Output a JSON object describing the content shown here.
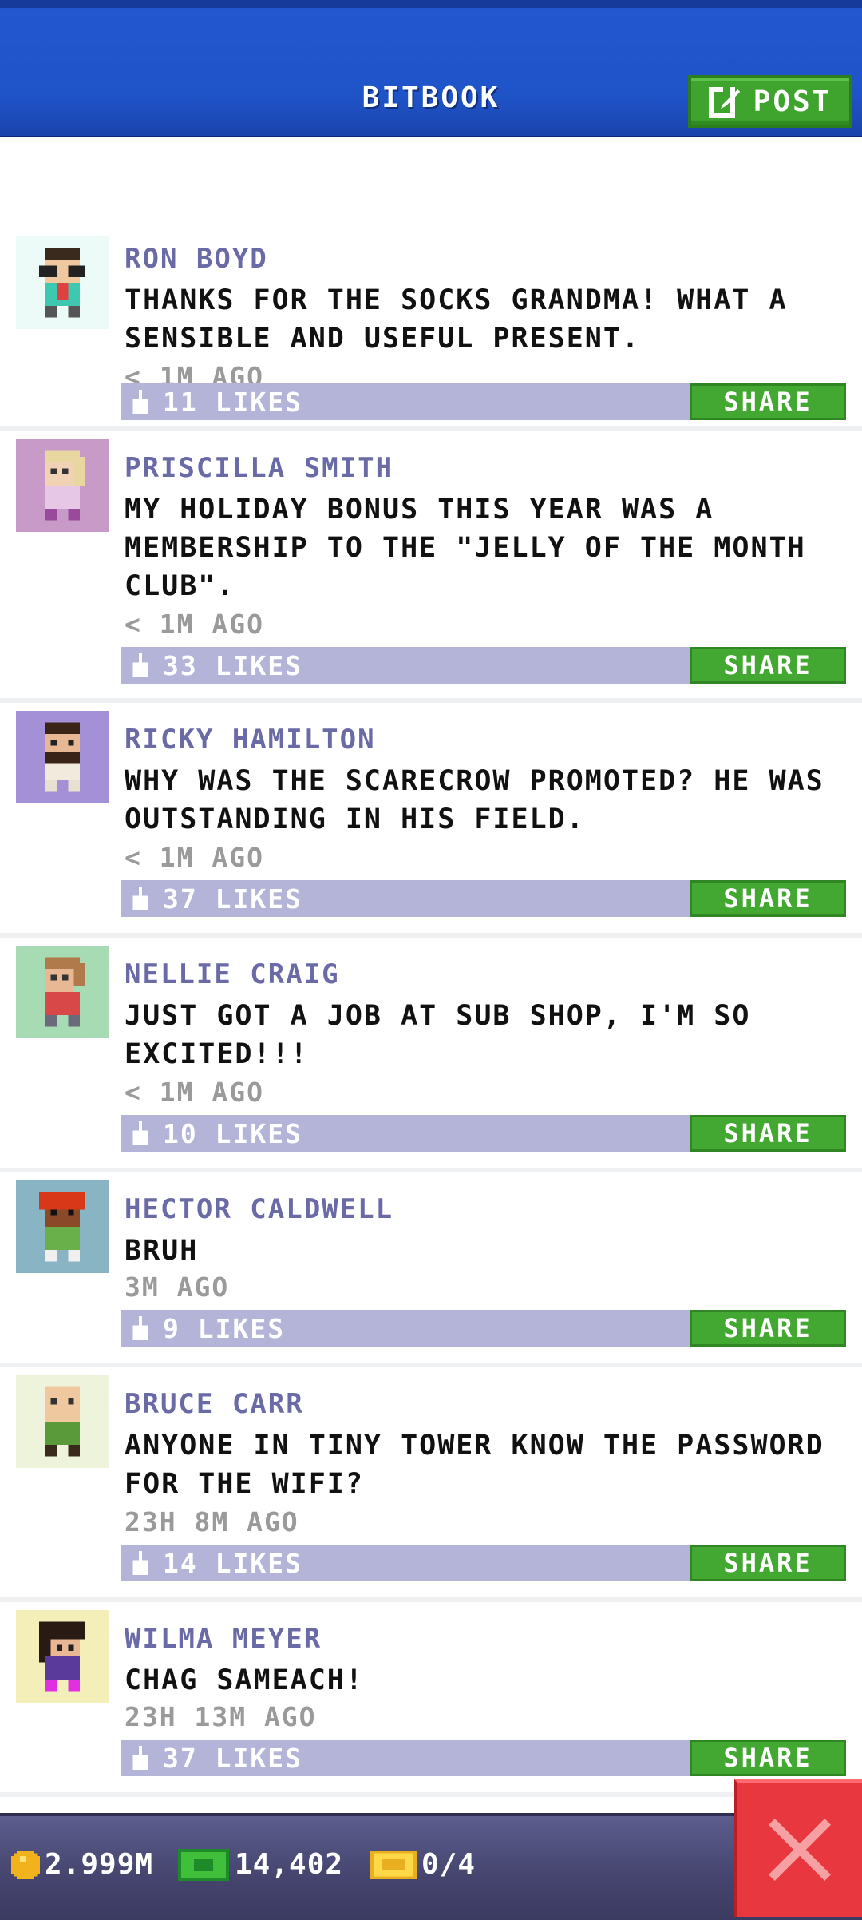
{
  "header": {
    "title": "BITBOOK",
    "post_label": "POST"
  },
  "share_label": "SHARE",
  "posts": [
    {
      "author": "RON BOYD",
      "message": "THANKS FOR THE SOCKS GRANDMA! WHAT A SENSIBLE AND USEFUL PRESENT.",
      "time": "< 1M AGO",
      "likes": "11 LIKES",
      "avatar_bg": "#ecfbf8",
      "avatar_icon": "person-glasses-icon"
    },
    {
      "author": "PRISCILLA SMITH",
      "message": "MY HOLIDAY BONUS THIS YEAR WAS A MEMBERSHIP TO THE \"JELLY OF THE MONTH CLUB\".",
      "time": "< 1M AGO",
      "likes": "33 LIKES",
      "avatar_bg": "#c89ac8",
      "avatar_icon": "person-icon"
    },
    {
      "author": "RICKY HAMILTON",
      "message": "WHY WAS THE SCARECROW PROMOTED? HE WAS OUTSTANDING IN HIS FIELD.",
      "time": "< 1M AGO",
      "likes": "37 LIKES",
      "avatar_bg": "#a490d6",
      "avatar_icon": "person-beard-icon"
    },
    {
      "author": "NELLIE CRAIG",
      "message": "JUST GOT A JOB AT SUB SHOP, I'M SO EXCITED!!!",
      "time": "< 1M AGO",
      "likes": "10 LIKES",
      "avatar_bg": "#a6dbb4",
      "avatar_icon": "person-icon"
    },
    {
      "author": "HECTOR CALDWELL",
      "message": "BRUH",
      "time": "3M AGO",
      "likes": "9 LIKES",
      "avatar_bg": "#88b4c4",
      "avatar_icon": "person-red-hair-icon"
    },
    {
      "author": "BRUCE CARR",
      "message": "ANYONE IN TINY TOWER KNOW THE PASSWORD FOR THE WIFI?",
      "time": "23H 8M AGO",
      "likes": "14 LIKES",
      "avatar_bg": "#eef3dc",
      "avatar_icon": "person-icon"
    },
    {
      "author": "WILMA MEYER",
      "message": "CHAG SAMEACH!",
      "time": "23H 13M AGO",
      "likes": "37 LIKES",
      "avatar_bg": "#f4efb8",
      "avatar_icon": "person-dark-hair-icon"
    }
  ],
  "footer": {
    "coins": "2.999M",
    "bux": "14,402",
    "tickets": "0/4"
  },
  "colors": {
    "header_blue": "#1f53c8",
    "share_green": "#43a831",
    "likes_bar": "#b3b4d8",
    "close_red": "#e8373f"
  }
}
